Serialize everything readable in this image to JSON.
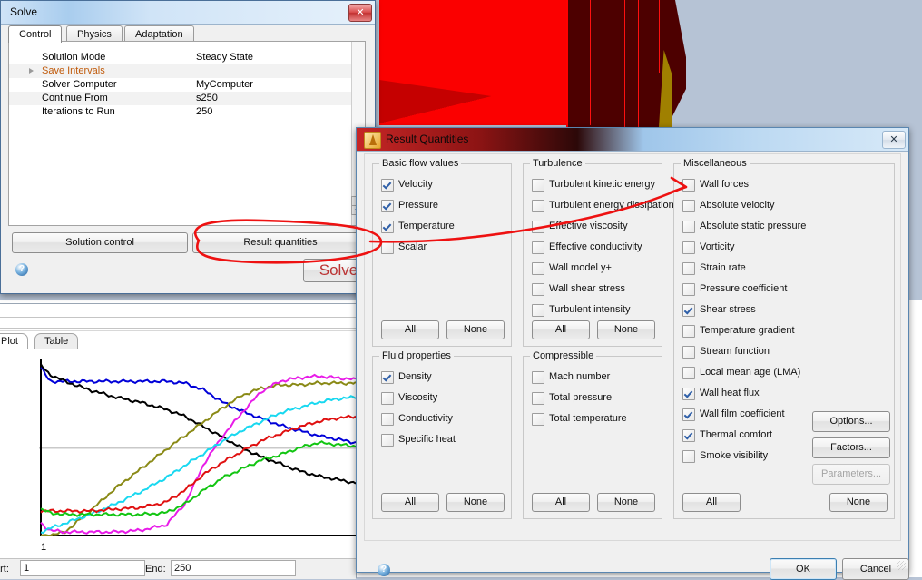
{
  "viewport": {
    "label": "3d-model-viewport"
  },
  "solve_window": {
    "title": "Solve",
    "close_label": "✕",
    "tabs": [
      {
        "label": "Control",
        "active": true
      },
      {
        "label": "Physics",
        "active": false
      },
      {
        "label": "Adaptation",
        "active": false
      }
    ],
    "grid_rows": [
      {
        "name": "Solution Mode",
        "value": "Steady State",
        "highlight": false,
        "expandable": false
      },
      {
        "name": "Save Intervals",
        "value": "",
        "highlight": true,
        "expandable": true
      },
      {
        "name": "Solver Computer",
        "value": "MyComputer",
        "highlight": false,
        "expandable": false
      },
      {
        "name": "Continue From",
        "value": "s250",
        "highlight": false,
        "expandable": false
      },
      {
        "name": "Iterations to Run",
        "value": "250",
        "highlight": false,
        "expandable": false
      }
    ],
    "solution_control_label": "Solution control",
    "result_quantities_label": "Result quantities",
    "solve_label": "Solve",
    "help_label": "?"
  },
  "plot_panel": {
    "tabs": [
      {
        "label": "Plot",
        "active": true
      },
      {
        "label": "Table",
        "active": false
      }
    ],
    "x_axis_start_tick": "1",
    "start_label": "art:",
    "start_value": "1",
    "end_label": "End:",
    "end_value": "250"
  },
  "chart_data": {
    "type": "line",
    "title": "",
    "xlabel": "",
    "ylabel": "",
    "xlim": [
      1,
      250
    ],
    "ylim": [
      0,
      1
    ],
    "xticks": [
      "1"
    ],
    "grid": false,
    "legend": "none",
    "x": [
      1,
      8,
      20,
      40,
      60,
      80,
      100,
      115,
      130,
      145,
      160,
      175,
      190,
      205,
      220,
      235,
      250
    ],
    "series": [
      {
        "name": "blue",
        "color": "#0000d8",
        "values": [
          0.96,
          0.88,
          0.88,
          0.88,
          0.88,
          0.88,
          0.88,
          0.87,
          0.83,
          0.76,
          0.71,
          0.67,
          0.63,
          0.6,
          0.57,
          0.55,
          0.53
        ]
      },
      {
        "name": "black",
        "color": "#000000",
        "values": [
          0.97,
          0.92,
          0.88,
          0.83,
          0.79,
          0.76,
          0.72,
          0.68,
          0.62,
          0.56,
          0.5,
          0.45,
          0.41,
          0.37,
          0.34,
          0.32,
          0.3
        ]
      },
      {
        "name": "olive",
        "color": "#8a8a16",
        "values": [
          0.0,
          0.0,
          0.02,
          0.14,
          0.27,
          0.38,
          0.49,
          0.57,
          0.65,
          0.73,
          0.8,
          0.84,
          0.86,
          0.86,
          0.87,
          0.87,
          0.87
        ]
      },
      {
        "name": "magenta",
        "color": "#e81ce8",
        "values": [
          0.07,
          0.03,
          0.02,
          0.02,
          0.02,
          0.03,
          0.06,
          0.18,
          0.41,
          0.57,
          0.7,
          0.82,
          0.88,
          0.9,
          0.91,
          0.9,
          0.89
        ]
      },
      {
        "name": "cyan",
        "color": "#18d8f0",
        "values": [
          0.02,
          0.04,
          0.07,
          0.12,
          0.18,
          0.25,
          0.33,
          0.4,
          0.47,
          0.54,
          0.6,
          0.65,
          0.7,
          0.73,
          0.76,
          0.78,
          0.79
        ]
      },
      {
        "name": "red",
        "color": "#e01010",
        "values": [
          0.14,
          0.14,
          0.14,
          0.14,
          0.15,
          0.16,
          0.19,
          0.26,
          0.35,
          0.42,
          0.48,
          0.54,
          0.58,
          0.62,
          0.65,
          0.67,
          0.68
        ]
      },
      {
        "name": "green",
        "color": "#12c512",
        "values": [
          0.15,
          0.13,
          0.12,
          0.12,
          0.12,
          0.12,
          0.13,
          0.18,
          0.26,
          0.33,
          0.38,
          0.43,
          0.46,
          0.5,
          0.53,
          0.52,
          0.51
        ]
      }
    ]
  },
  "result_quantities": {
    "title": "Result Quantities",
    "close_label": "✕",
    "help_label": "?",
    "all_label": "All",
    "none_label": "None",
    "ok_label": "OK",
    "cancel_label": "Cancel",
    "groups": [
      {
        "id": "basic-flow-values",
        "title": "Basic flow values",
        "items": [
          {
            "label": "Velocity",
            "checked": true
          },
          {
            "label": "Pressure",
            "checked": true
          },
          {
            "label": "Temperature",
            "checked": true
          },
          {
            "label": "Scalar",
            "checked": false
          }
        ]
      },
      {
        "id": "turbulence",
        "title": "Turbulence",
        "items": [
          {
            "label": "Turbulent kinetic energy",
            "checked": false
          },
          {
            "label": "Turbulent energy dissipation",
            "checked": false
          },
          {
            "label": "Effective viscosity",
            "checked": false
          },
          {
            "label": "Effective conductivity",
            "checked": false
          },
          {
            "label": "Wall model y+",
            "checked": false
          },
          {
            "label": "Wall shear stress",
            "checked": false
          },
          {
            "label": "Turbulent intensity",
            "checked": false
          }
        ]
      },
      {
        "id": "miscellaneous",
        "title": "Miscellaneous",
        "items": [
          {
            "label": "Wall forces",
            "checked": false
          },
          {
            "label": "Absolute velocity",
            "checked": false
          },
          {
            "label": "Absolute static pressure",
            "checked": false
          },
          {
            "label": "Vorticity",
            "checked": false
          },
          {
            "label": "Strain rate",
            "checked": false
          },
          {
            "label": "Pressure coefficient",
            "checked": false
          },
          {
            "label": "Shear stress",
            "checked": true
          },
          {
            "label": "Temperature gradient",
            "checked": false
          },
          {
            "label": "Stream function",
            "checked": false
          },
          {
            "label": "Local mean age (LMA)",
            "checked": false
          },
          {
            "label": "Wall heat flux",
            "checked": true
          },
          {
            "label": "Wall film coefficient",
            "checked": true
          },
          {
            "label": "Thermal comfort",
            "checked": true
          },
          {
            "label": "Smoke visibility",
            "checked": false
          }
        ],
        "side_buttons": [
          {
            "label": "Options...",
            "enabled": true
          },
          {
            "label": "Factors...",
            "enabled": true
          },
          {
            "label": "Parameters...",
            "enabled": false
          }
        ]
      },
      {
        "id": "fluid-properties",
        "title": "Fluid properties",
        "items": [
          {
            "label": "Density",
            "checked": true
          },
          {
            "label": "Viscosity",
            "checked": false
          },
          {
            "label": "Conductivity",
            "checked": false
          },
          {
            "label": "Specific heat",
            "checked": false
          }
        ]
      },
      {
        "id": "compressible",
        "title": "Compressible",
        "items": [
          {
            "label": "Mach number",
            "checked": false
          },
          {
            "label": "Total pressure",
            "checked": false
          },
          {
            "label": "Total temperature",
            "checked": false
          }
        ]
      }
    ]
  },
  "annotation": {
    "color": "#ee1111",
    "description": "red hand-drawn ellipse around Result quantities button with arrow pointing to Wall forces checkbox"
  }
}
